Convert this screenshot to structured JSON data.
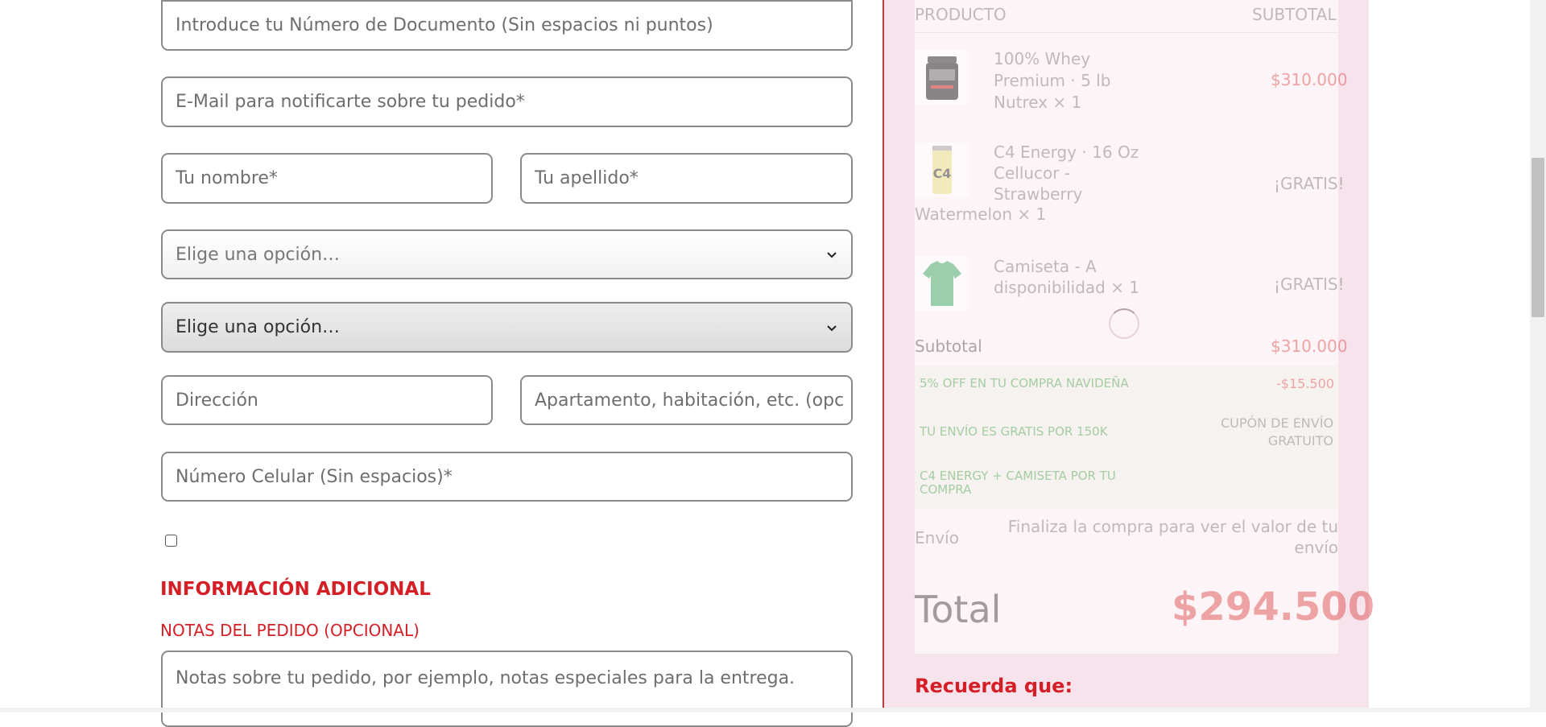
{
  "form": {
    "document_placeholder": "Introduce tu Número de Documento (Sin espacios ni puntos)",
    "email_placeholder": "E-Mail para notificarte sobre tu pedido*",
    "first_name_placeholder": "Tu nombre*",
    "last_name_placeholder": "Tu apellido*",
    "select1_value": "Elige una opción…",
    "select2_value": "Elige una opción…",
    "address_placeholder": "Dirección",
    "address2_placeholder": "Apartamento, habitación, etc. (opc",
    "phone_placeholder": "Número Celular (Sin espacios)*",
    "additional_info_heading": "INFORMACIÓN ADICIONAL",
    "notes_label": "NOTAS DEL PEDIDO (OPCIONAL)",
    "notes_placeholder": "Notas sobre tu pedido, por ejemplo, notas especiales para la entrega."
  },
  "order": {
    "col_product": "PRODUCTO",
    "col_subtotal": "SUBTOTAL",
    "items": [
      {
        "name_l1": "100% Whey",
        "name_l2": "Premium · 5 lb",
        "name_l3": "Nutrex",
        "qty": "× 1",
        "price": "$310.000",
        "icon": "protein-tub-icon"
      },
      {
        "name_l1": "C4 Energy · 16 Oz",
        "name_l2": "Cellucor -",
        "name_l3": "Strawberry",
        "name_l4": "Watermelon",
        "qty": "× 1",
        "price": "¡GRATIS!",
        "icon": "energy-can-icon"
      },
      {
        "name_l1": "Camiseta - A",
        "name_l2": "disponibilidad",
        "qty": "× 1",
        "price": "¡GRATIS!",
        "icon": "tshirt-icon"
      }
    ],
    "subtotal_label": "Subtotal",
    "subtotal_value": "$310.000",
    "coupons": [
      {
        "label": "5% OFF EN TU COMPRA NAVIDEÑA",
        "value": "-$15.500"
      },
      {
        "label": "TU ENVÍO ES GRATIS POR 150K",
        "value_l1": "CUPÓN DE ENVÍO",
        "value_l2": "GRATUITO"
      },
      {
        "label_l1": "C4 ENERGY + CAMISETA POR TU",
        "label_l2": "COMPRA",
        "value": ""
      }
    ],
    "shipping_label": "Envío",
    "shipping_l1": "Finaliza la compra para ver el valor de tu",
    "shipping_l2": "envío",
    "total_label": "Total",
    "total_value": "$294.500",
    "reminder_heading": "Recuerda que:"
  },
  "colors": {
    "accent_red": "#d51f26",
    "price_red": "#e06060",
    "coupon_green": "#5dac5d",
    "sidebar_bg": "#f7e3ec"
  }
}
